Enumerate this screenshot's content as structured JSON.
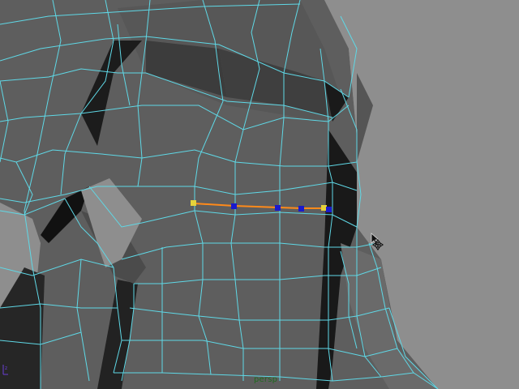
{
  "viewport": {
    "camera_label": "persp",
    "background_color": "#8e8e8e",
    "wireframe_color": "#5fd8e6",
    "selected_edge_color": "#ff8a1a",
    "vertex_highlight_color": "#e5d23a",
    "vertex_color": "#1a1acc"
  },
  "icons": {
    "axis": "axis-gizmo-icon",
    "cursor": "move-cursor-icon"
  }
}
